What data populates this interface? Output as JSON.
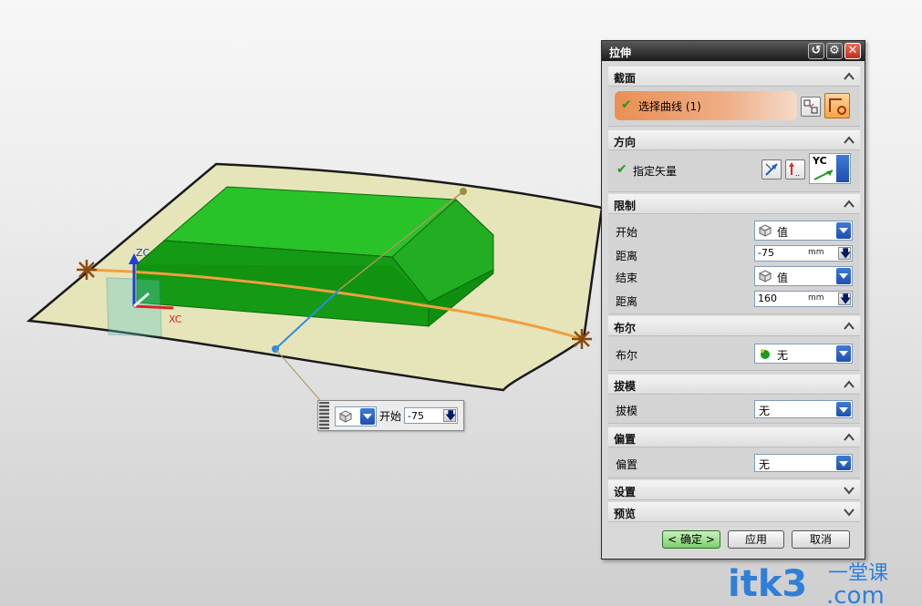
{
  "dialog": {
    "title": "拉伸",
    "sections": {
      "section_curve": {
        "header": "截面",
        "select_curve_label": "选择曲线 (1)"
      },
      "direction": {
        "header": "方向",
        "specify_vector_label": "指定矢量",
        "vector_option": "YC"
      },
      "limits": {
        "header": "限制",
        "start_label": "开始",
        "start_option": "值",
        "start_distance_label": "距离",
        "start_distance_value": "-75",
        "start_unit": "mm",
        "end_label": "结束",
        "end_option": "值",
        "end_distance_label": "距离",
        "end_distance_value": "160",
        "end_unit": "mm"
      },
      "boolean": {
        "header": "布尔",
        "label": "布尔",
        "value": "无"
      },
      "draft": {
        "header": "拔模",
        "label": "拔模",
        "value": "无"
      },
      "offset": {
        "header": "偏置",
        "label": "偏置",
        "value": "无"
      },
      "settings": {
        "header": "设置"
      },
      "preview": {
        "header": "预览"
      }
    },
    "buttons": {
      "ok": "< 确定 >",
      "apply": "应用",
      "cancel": "取消"
    }
  },
  "viewport": {
    "axis_z": "ZC",
    "axis_x": "XC",
    "float_toolbar": {
      "label": "开始",
      "value": "-75"
    }
  },
  "watermark": {
    "brand": "itk3",
    "domain": ".com",
    "cn": "一堂课"
  },
  "colors": {
    "sheet": "#e6e5ba",
    "solid_top": "#1fb81f",
    "solid_side": "#0e8f0e",
    "curve": "#f0a040",
    "vector": "#2e8be0",
    "accent_orange": "#e98f55"
  }
}
